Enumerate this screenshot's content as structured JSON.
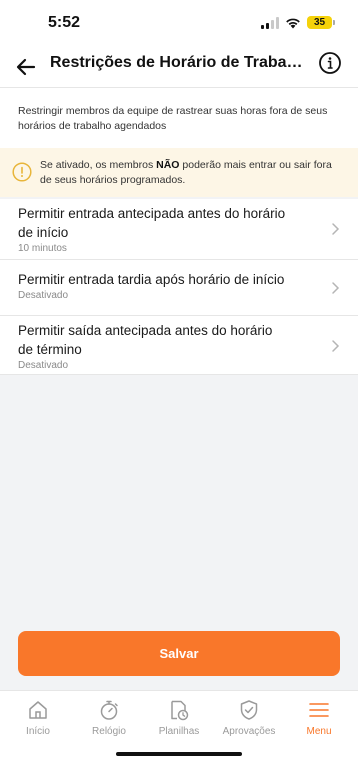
{
  "status_bar": {
    "time": "5:52",
    "battery": "35"
  },
  "header": {
    "title": "Restrições de Horário de Trabalho"
  },
  "description": "Restringir membros da equipe de rastrear suas horas fora de seus horários de trabalho agendados",
  "warning": {
    "prefix": "Se ativado, os membros ",
    "emphasis": "NÃO",
    "suffix": " poderão mais entrar ou sair fora de seus horários programados."
  },
  "settings": [
    {
      "title": "Permitir entrada antecipada antes do horário de início",
      "value": "10 minutos"
    },
    {
      "title": "Permitir entrada tardia após horário de início",
      "value": "Desativado"
    },
    {
      "title": "Permitir saída antecipada antes do horário de término",
      "value": "Desativado"
    }
  ],
  "save_button": {
    "label": "Salvar"
  },
  "tab_bar": {
    "tabs": [
      {
        "label": "Início",
        "icon": "home-icon"
      },
      {
        "label": "Relógio",
        "icon": "stopwatch-icon"
      },
      {
        "label": "Planilhas",
        "icon": "timesheet-icon"
      },
      {
        "label": "Aprovações",
        "icon": "shield-check-icon"
      },
      {
        "label": "Menu",
        "icon": "menu-icon",
        "active": true
      }
    ]
  },
  "colors": {
    "accent": "#f9772a",
    "warning_bg": "#fdf6e6",
    "warning_icon": "#e8b53a",
    "battery": "#f5d20a"
  }
}
